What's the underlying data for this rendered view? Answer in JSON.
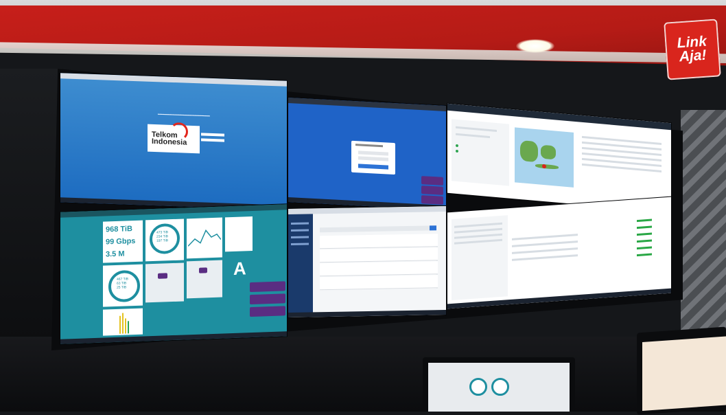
{
  "brand": {
    "logo_line1": "Link",
    "logo_line2": "Aja!"
  },
  "screens": {
    "login": {
      "company_line1": "Telkom",
      "company_line2": "Indonesia"
    },
    "panel4": {
      "stat1": "968 TiB",
      "stat2": "99 Gbps",
      "stat3": "3.5 M",
      "ring1_a": "473 TiB",
      "ring1_b": "234 TiB",
      "ring1_c": "197 TiB",
      "ring2_a": "467 TiB",
      "ring2_b": "63 TiB",
      "ring2_c": "25 TiB",
      "letter": "A"
    }
  },
  "colors": {
    "brand_red": "#d9251d",
    "screen_blue": "#1f63c7",
    "teal": "#1e8fa0"
  }
}
